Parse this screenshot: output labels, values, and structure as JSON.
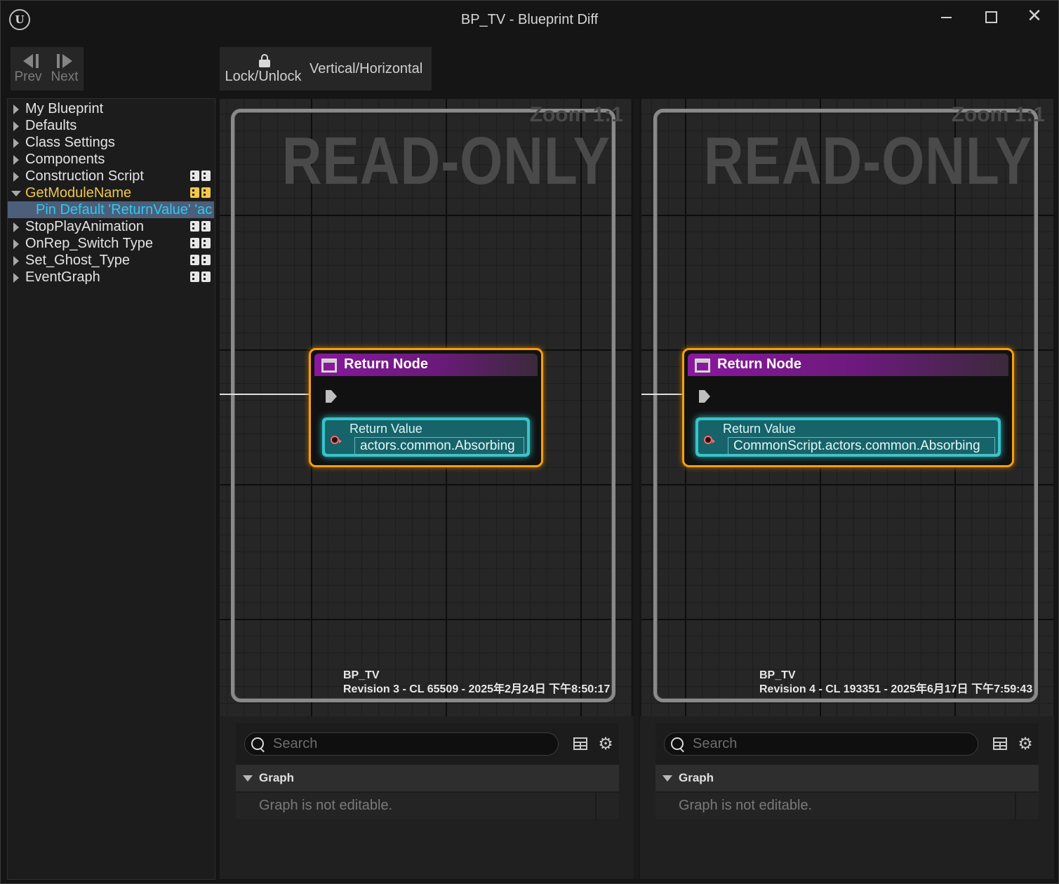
{
  "window": {
    "title": "BP_TV - Blueprint Diff",
    "logo_text": "U",
    "close_glyph": "✕"
  },
  "nav": {
    "prev_label": "Prev",
    "next_label": "Next"
  },
  "toolbar": {
    "lock_label": "Lock/Unlock",
    "orientation_label": "Vertical/Horizontal"
  },
  "tree": {
    "items": [
      {
        "label": "My Blueprint",
        "graph_icon": false
      },
      {
        "label": "Defaults",
        "graph_icon": false
      },
      {
        "label": "Class Settings",
        "graph_icon": false
      },
      {
        "label": "Components",
        "graph_icon": false
      },
      {
        "label": "Construction Script",
        "graph_icon": true
      },
      {
        "label": "GetModuleName",
        "graph_icon": true,
        "expanded": true,
        "highlight_color": "#f0c64b"
      },
      {
        "label": "Pin Default 'ReturnValue' 'ac",
        "child": true,
        "selected": true,
        "color": "#30c9ee"
      },
      {
        "label": "StopPlayAnimation",
        "graph_icon": true
      },
      {
        "label": "OnRep_Switch Type",
        "graph_icon": true
      },
      {
        "label": "Set_Ghost_Type",
        "graph_icon": true
      },
      {
        "label": "EventGraph",
        "graph_icon": true
      }
    ]
  },
  "panels": {
    "left": {
      "read_only_label": "READ-ONLY",
      "zoom_label": "Zoom 1:1",
      "node": {
        "title": "Return Node",
        "pin_label": "Return Value",
        "pin_value": "actors.common.Absorbing"
      },
      "asset_name": "BP_TV",
      "revision": "Revision 3 - CL 65509 - 2025年2月24日 下午8:50:17",
      "search_placeholder": "Search",
      "category": "Graph",
      "message": "Graph is not editable."
    },
    "right": {
      "read_only_label": "READ-ONLY",
      "zoom_label": "Zoom 1:1",
      "node": {
        "title": "Return Node",
        "pin_label": "Return Value",
        "pin_value": "CommonScript.actors.common.Absorbing"
      },
      "asset_name": "BP_TV",
      "revision": "Revision 4 - CL 193351 - 2025年6月17日 下午7:59:43",
      "search_placeholder": "Search",
      "category": "Graph",
      "message": "Graph is not editable."
    }
  },
  "colors": {
    "node_border": "#f5a00f",
    "node_header": "#8a189e",
    "string_pin": "#37c4c9",
    "selection": "#4b5f7a"
  }
}
